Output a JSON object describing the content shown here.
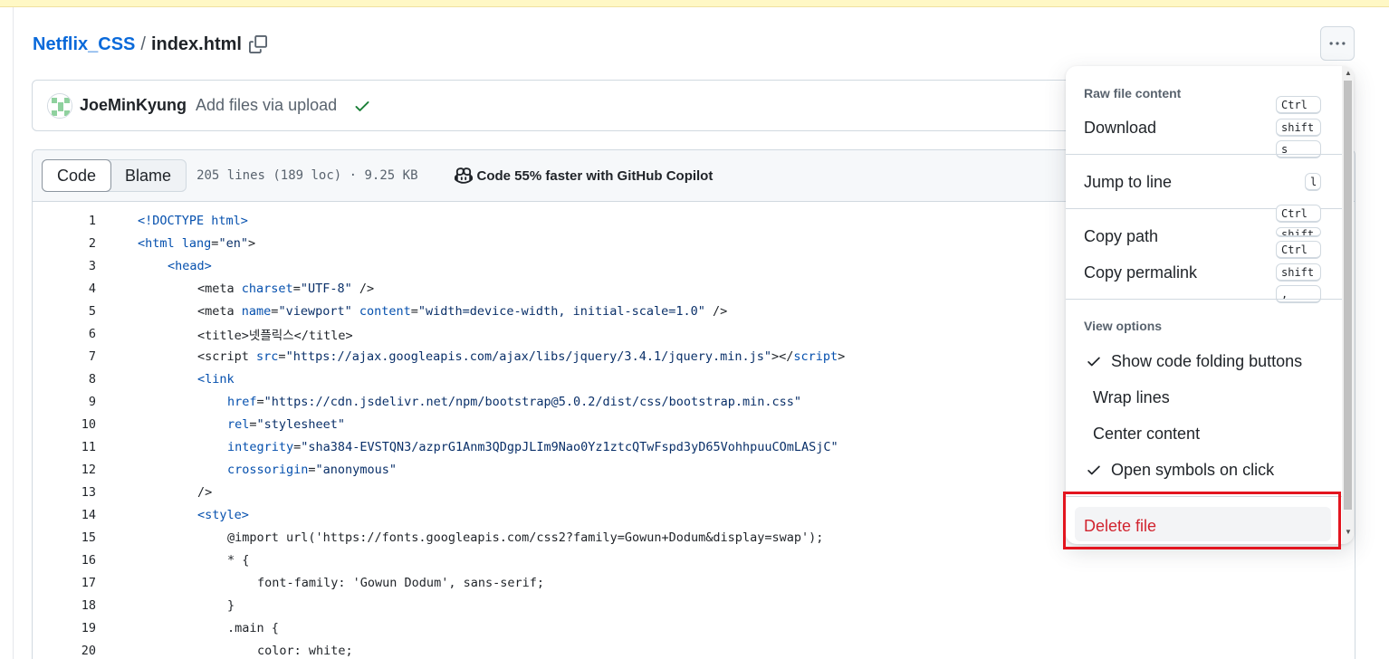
{
  "breadcrumb": {
    "repo": "Netflix_CSS",
    "separator": "/",
    "file": "index.html"
  },
  "commit": {
    "author": "JoeMinKyung",
    "message": "Add files via upload"
  },
  "code_header": {
    "tab_code": "Code",
    "tab_blame": "Blame",
    "meta": "205 lines (189 loc) · 9.25 KB",
    "copilot": "Code 55% faster with GitHub Copilot"
  },
  "code_lines": [
    {
      "n": "1"
    },
    {
      "n": "2"
    },
    {
      "n": "3"
    },
    {
      "n": "4"
    },
    {
      "n": "5"
    },
    {
      "n": "6"
    },
    {
      "n": "7"
    },
    {
      "n": "8"
    },
    {
      "n": "9"
    },
    {
      "n": "10"
    },
    {
      "n": "11"
    },
    {
      "n": "12"
    },
    {
      "n": "13"
    },
    {
      "n": "14"
    },
    {
      "n": "15"
    },
    {
      "n": "16"
    },
    {
      "n": "17"
    },
    {
      "n": "18"
    },
    {
      "n": "19"
    },
    {
      "n": "20"
    }
  ],
  "code": {
    "l1": "<!DOCTYPE html>",
    "l2a": "<html ",
    "l2b": "lang",
    "l2c": "=",
    "l2d": "\"en\"",
    "l2e": ">",
    "l3": "<head>",
    "l4a": "<meta ",
    "l4b": "charset",
    "l4c": "=",
    "l4d": "\"UTF-8\"",
    "l4e": " />",
    "l5a": "<meta ",
    "l5b": "name",
    "l5c": "=",
    "l5d": "\"viewport\"",
    "l5e": " content",
    "l5f": "=",
    "l5g": "\"width=device-width, initial-scale=1.0\"",
    "l5h": " />",
    "l6a": "<title>",
    "l6b": "넷플릭스",
    "l6c": "</title>",
    "l7a": "<script ",
    "l7b": "src",
    "l7c": "=",
    "l7d": "\"https://ajax.googleapis.com/ajax/libs/jquery/3.4.1/jquery.min.js\"",
    "l7e": "></",
    "l7f": "script",
    "l7g": ">",
    "l8": "<link",
    "l9a": "href",
    "l9b": "=",
    "l9c": "\"https://cdn.jsdelivr.net/npm/bootstrap@5.0.2/dist/css/bootstrap.min.css\"",
    "l10a": "rel",
    "l10b": "=",
    "l10c": "\"stylesheet\"",
    "l11a": "integrity",
    "l11b": "=",
    "l11c": "\"sha384-EVSTQN3/azprG1Anm3QDgpJLIm9Nao0Yz1ztcQTwFspd3yD65VohhpuuCOmLASjC\"",
    "l12a": "crossorigin",
    "l12b": "=",
    "l12c": "\"anonymous\"",
    "l13": "/>",
    "l14": "<style>",
    "l15": "@import url('https://fonts.googleapis.com/css2?family=Gowun+Dodum&display=swap');",
    "l16": "* {",
    "l17": "font-family: 'Gowun Dodum', sans-serif;",
    "l18": "}",
    "l19": ".main {",
    "l20": "color: white;"
  },
  "menu": {
    "raw_group": "Raw file content",
    "download": "Download",
    "download_keys": [
      "Ctrl",
      "shift",
      "s"
    ],
    "jump": "Jump to line",
    "jump_key": "l",
    "copy_path": "Copy path",
    "copy_path_keys": [
      "Ctrl",
      "shift"
    ],
    "copy_permalink": "Copy permalink",
    "copy_permalink_keys": [
      "Ctrl",
      "shift",
      ","
    ],
    "view_group": "View options",
    "opt_folding": "Show code folding buttons",
    "opt_wrap": "Wrap lines",
    "opt_center": "Center content",
    "opt_symbols": "Open symbols on click",
    "delete": "Delete file"
  },
  "colors": {
    "link": "#0969da",
    "danger": "#d1242f",
    "success": "#1a7f37",
    "highlight": "#e3151f"
  }
}
